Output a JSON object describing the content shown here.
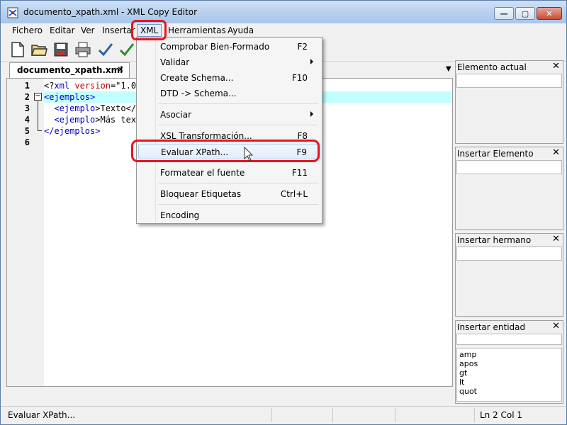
{
  "window": {
    "title": "documento_xpath.xml - XML Copy Editor",
    "min": "—",
    "max": "▢",
    "close": "✕"
  },
  "menubar": [
    "Fichero",
    "Editar",
    "Ver",
    "Insertar",
    "XML",
    "Herramientas",
    "Ayuda"
  ],
  "doc_tab": {
    "label": "documento_xpath.xml",
    "close": "✕",
    "dropdown": "▼"
  },
  "editor": {
    "line_numbers": [
      "1",
      "2",
      "3",
      "4",
      "5",
      "6"
    ],
    "lines": {
      "l1_a": "<?",
      "l1_b": "xml",
      "l1_c": " version",
      "l1_d": "=\"1.0\"",
      "l2": "<ejemplos>",
      "l3_a": "  <ejemplo",
      "l3_b": ">Texto</",
      "l4_a": "  <ejemplo",
      "l4_b": ">Más tex",
      "l5": "</ejemplos>"
    },
    "fold": "−"
  },
  "xml_menu": {
    "items": [
      {
        "label": "Comprobar Bien-Formado",
        "key": "F2"
      },
      {
        "label": "Validar",
        "key": ""
      },
      {
        "label": "Create Schema...",
        "key": "F10"
      },
      {
        "label": "DTD -> Schema...",
        "key": ""
      },
      {
        "label": "Asociar",
        "key": ""
      },
      {
        "label": "XSL Transformación...",
        "key": "F8"
      },
      {
        "label": "Evaluar XPath...",
        "key": "F9"
      },
      {
        "label": "Formatear el fuente",
        "key": "F11"
      },
      {
        "label": "Bloquear Etiquetas",
        "key": "Ctrl+L"
      },
      {
        "label": "Encoding",
        "key": ""
      }
    ]
  },
  "panels": {
    "elemento_actual": "Elemento actual",
    "insertar_elemento": "Insertar Elemento",
    "insertar_hermano": "Insertar hermano",
    "insertar_entidad": "Insertar entidad",
    "close": "✕",
    "entities": [
      "amp",
      "apos",
      "gt",
      "lt",
      "quot"
    ]
  },
  "status": {
    "text": "Evaluar XPath...",
    "position": "Ln 2 Col 1"
  },
  "colors": {
    "highlight": "#e8141d",
    "tag": "#0000c0",
    "attr": "#c00000",
    "current_line": "#bfffff"
  }
}
